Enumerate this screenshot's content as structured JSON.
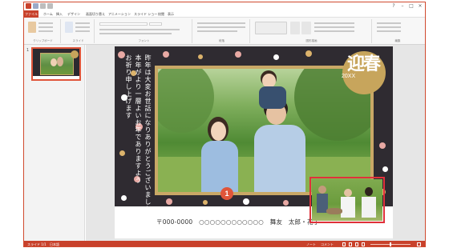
{
  "window": {
    "tabs": [
      "ファイル",
      "ホーム",
      "挿入",
      "デザイン",
      "画面切り替え",
      "アニメーション",
      "スライド ショー",
      "校閲",
      "表示"
    ]
  },
  "ribbon": {
    "groups": [
      "クリップボード",
      "スライド",
      "フォント",
      "段落",
      "図形描画",
      "編集"
    ]
  },
  "slides_panel": {
    "thumb_number": "1"
  },
  "slide": {
    "greeting_lines": [
      "昨年は大変お世話になりありがとうございました。",
      "本年がより一層よいお年でありますよう",
      "お祈り申し上げます"
    ],
    "badge_text": "迎春",
    "badge_year": "20XX",
    "address_line": "〒000-0000　○○○○○○○○○○○○　舞友　太郎・花子",
    "callout_number": "1"
  },
  "statusbar": {
    "slide_info": "スライド 1/1",
    "language": "日本語",
    "notes": "ノート",
    "comments": "コメント"
  },
  "colors": {
    "accent": "#c8412b",
    "slide_bg": "#2f2b31",
    "gold": "#c7a55c",
    "highlight": "#e0313a"
  }
}
